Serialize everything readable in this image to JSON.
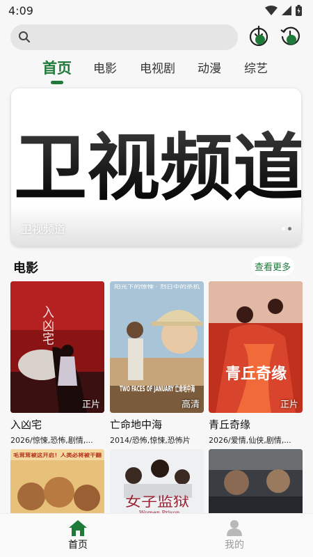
{
  "status_bar": {
    "time": "4:09"
  },
  "search": {
    "placeholder": ""
  },
  "tabs": [
    {
      "label": "首页",
      "active": true
    },
    {
      "label": "电影",
      "active": false
    },
    {
      "label": "电视剧",
      "active": false
    },
    {
      "label": "动漫",
      "active": false
    },
    {
      "label": "综艺",
      "active": false
    }
  ],
  "banner": {
    "headline": "卫视频道",
    "caption": "卫视频道",
    "page_count": 2,
    "active_page": 2
  },
  "section": {
    "title": "电影",
    "more_label": "查看更多"
  },
  "movies": [
    {
      "title": "入凶宅",
      "meta": "2026/惊悚,恐怖,剧情,...",
      "badge": "正片",
      "poster_text": "入凶宅"
    },
    {
      "title": "亡命地中海",
      "meta": "2014/恐怖,惊悚,恐怖片",
      "badge": "高清",
      "poster_text": "TWO FACES OF JANUARY 亡命地中海",
      "poster_caption": "阳光下的惊悚 · 烈日中的杀机"
    },
    {
      "title": "青丘奇缘",
      "meta": "2026/爱情,仙侠,剧情,...",
      "badge": "正片",
      "poster_text": "青丘奇缘"
    }
  ],
  "movies_row2": [
    {
      "poster_text": "毛茸茸被这开启！人类必将被干翻"
    },
    {
      "poster_text": "女子监狱",
      "poster_caption": "Women Prison"
    },
    {
      "poster_text": ""
    }
  ],
  "bottom_nav": [
    {
      "label": "首页",
      "active": true,
      "icon": "home-icon"
    },
    {
      "label": "我的",
      "active": false,
      "icon": "user-icon"
    }
  ],
  "colors": {
    "accent": "#1f7a3a",
    "background": "#f7f7f7",
    "inactive": "#9a9a9a"
  }
}
